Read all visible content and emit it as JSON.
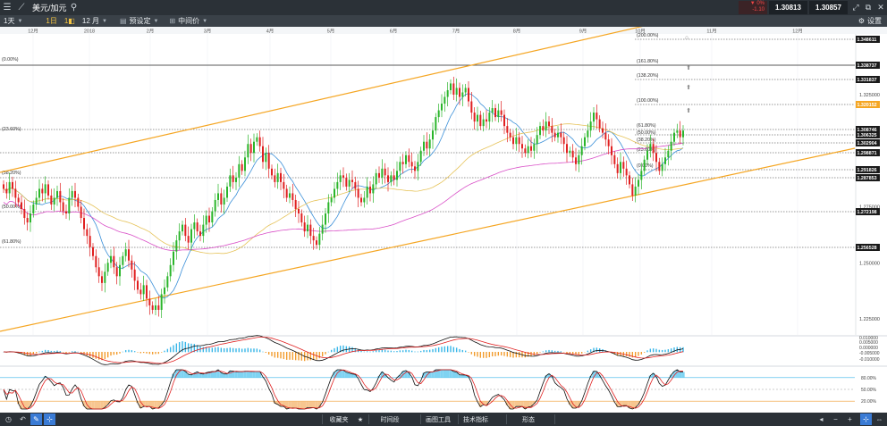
{
  "app": {
    "symbol": "美元/加元",
    "quote_change": "▼ 0%",
    "quote_change_sub": "-1.10",
    "bid": "1.30813",
    "ask": "1.30857"
  },
  "toolbar": {
    "timeframe": "1天",
    "chart_type": "1日",
    "chart_type2": "1◧",
    "period": "12 月",
    "preset": "预设定",
    "price_type": "中间价",
    "settings": "设置"
  },
  "bottombar": {
    "favorites": "收藏夹",
    "timeframe": "时间段",
    "drawing_tools": "画图工具",
    "indicators": "技术指标",
    "shapes": "形态"
  },
  "colors": {
    "channel": "#f5a623",
    "ma_fast": "#3a8fd8",
    "ma_mid": "#e6c35a",
    "ma_slow": "#d94fc7",
    "bull": "#2ab52a",
    "bear": "#e02020",
    "last_price_tag": "#f5a623"
  },
  "chart_data": {
    "type": "candlestick",
    "x_months": [
      "12月",
      "2018",
      "2月",
      "3月",
      "4月",
      "5月",
      "6月",
      "7月",
      "8月",
      "9月",
      "10月",
      "11月",
      "12月"
    ],
    "y_ticks": [
      "1.325000",
      "1.300000",
      "1.275000",
      "1.250000",
      "1.225000"
    ],
    "price_labels": [
      "1.348611",
      "1.338737",
      "1.331837",
      "1.320152",
      "1.308746",
      "1.306325",
      "1.302904",
      "1.298871",
      "1.291826",
      "1.287853",
      "1.272198",
      "1.256528"
    ],
    "last_price": "1.320152",
    "fib_left": [
      "(0.00%)",
      "(23.60%)",
      "(38.20%)",
      "(50.00%)",
      "(61.80%)"
    ],
    "fib_right": [
      "(200.00%)",
      "(161.80%)",
      "(138.20%)",
      "(100.00%)",
      "(61.80%)",
      "(50.00%)",
      "(38.20%)",
      "(23.60%)",
      "(0.00%)"
    ],
    "close": [
      1.283,
      1.281,
      1.286,
      1.283,
      1.279,
      1.277,
      1.274,
      1.27,
      1.268,
      1.272,
      1.276,
      1.279,
      1.283,
      1.281,
      1.285,
      1.28,
      1.276,
      1.279,
      1.282,
      1.277,
      1.273,
      1.272,
      1.279,
      1.282,
      1.279,
      1.275,
      1.27,
      1.265,
      1.262,
      1.257,
      1.253,
      1.248,
      1.244,
      1.241,
      1.246,
      1.25,
      1.253,
      1.248,
      1.244,
      1.249,
      1.253,
      1.256,
      1.251,
      1.247,
      1.242,
      1.238,
      1.236,
      1.24,
      1.234,
      1.231,
      1.229,
      1.231,
      1.229,
      1.236,
      1.239,
      1.244,
      1.249,
      1.255,
      1.26,
      1.264,
      1.267,
      1.262,
      1.259,
      1.265,
      1.268,
      1.264,
      1.262,
      1.267,
      1.271,
      1.268,
      1.273,
      1.278,
      1.281,
      1.276,
      1.279,
      1.284,
      1.289,
      1.286,
      1.288,
      1.294,
      1.291,
      1.297,
      1.303,
      1.299,
      1.304,
      1.306,
      1.302,
      1.295,
      1.299,
      1.292,
      1.289,
      1.286,
      1.29,
      1.286,
      1.283,
      1.279,
      1.281,
      1.278,
      1.274,
      1.272,
      1.268,
      1.264,
      1.267,
      1.262,
      1.26,
      1.258,
      1.263,
      1.267,
      1.272,
      1.277,
      1.279,
      1.283,
      1.286,
      1.289,
      1.288,
      1.284,
      1.287,
      1.286,
      1.283,
      1.279,
      1.277,
      1.279,
      1.284,
      1.281,
      1.285,
      1.29,
      1.288,
      1.292,
      1.289,
      1.286,
      1.289,
      1.287,
      1.291,
      1.295,
      1.294,
      1.298,
      1.295,
      1.293,
      1.291,
      1.295,
      1.3,
      1.304,
      1.301,
      1.305,
      1.309,
      1.315,
      1.318,
      1.321,
      1.324,
      1.327,
      1.33,
      1.325,
      1.328,
      1.324,
      1.326,
      1.328,
      1.322,
      1.317,
      1.313,
      1.316,
      1.311,
      1.314,
      1.313,
      1.317,
      1.319,
      1.315,
      1.318,
      1.316,
      1.311,
      1.308,
      1.306,
      1.303,
      1.306,
      1.303,
      1.301,
      1.299,
      1.302,
      1.3,
      1.303,
      1.307,
      1.311,
      1.309,
      1.313,
      1.311,
      1.308,
      1.306,
      1.308,
      1.306,
      1.303,
      1.299,
      1.3,
      1.297,
      1.294,
      1.298,
      1.302,
      1.306,
      1.309,
      1.313,
      1.317,
      1.314,
      1.31,
      1.308,
      1.305,
      1.302,
      1.298,
      1.294,
      1.29,
      1.295,
      1.292,
      1.289,
      1.285,
      1.28,
      1.284,
      1.287,
      1.291,
      1.296,
      1.3,
      1.303,
      1.299,
      1.295,
      1.291,
      1.294,
      1.297,
      1.3,
      1.304,
      1.308,
      1.309,
      1.306,
      1.309
    ],
    "macd_ticks": [
      "0.010000",
      "0.005000",
      "0.000000",
      "-0.005000",
      "-0.010000"
    ],
    "stoch_ticks": [
      "80.00%",
      "50.00%",
      "20.00%"
    ]
  }
}
